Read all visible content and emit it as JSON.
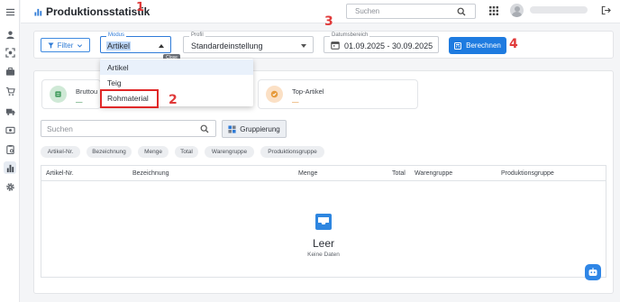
{
  "header": {
    "title": "Produktionsstatistik",
    "annotation_1": "1",
    "search_placeholder": "Suchen"
  },
  "sidebar": {
    "icons": [
      "menu-icon",
      "user-icon",
      "scan-icon",
      "briefcase-icon",
      "cart-icon",
      "truck-icon",
      "cash-icon",
      "clipboard-icon",
      "chart-icon",
      "gear-icon"
    ],
    "active": "chart-icon"
  },
  "filterbar": {
    "filter_label": "Filter",
    "modus": {
      "label": "Modus",
      "value": "Artikel"
    },
    "profil": {
      "label": "Profil",
      "value": "Standardeinstellung"
    },
    "datum": {
      "label": "Datumsbereich",
      "value": "01.09.2025 - 30.09.2025"
    },
    "annotation_3": "3",
    "berechnen_label": "Berechnen",
    "annotation_4": "4"
  },
  "dropdown": {
    "options": [
      "Artikel",
      "Teig",
      "Rohmaterial"
    ],
    "selected": "Artikel",
    "close_tooltip": "Close",
    "annotation_2": "2"
  },
  "stats": [
    {
      "label": "Bruttou",
      "value": "—",
      "color": "#2f8a4a"
    },
    {
      "label": "Top-Artikel",
      "value": "—",
      "color": "#e08a2a"
    }
  ],
  "toolbar": {
    "search_placeholder": "Suchen",
    "grouping_label": "Gruppierung"
  },
  "chips": [
    "Artikel-Nr.",
    "Bezeichnung",
    "Menge",
    "Total",
    "Warengruppe",
    "Produktionsgruppe"
  ],
  "table": {
    "columns": [
      "Artikel-Nr.",
      "Bezeichnung",
      "Menge",
      "Total",
      "Warengruppe",
      "Produktionsgruppe"
    ],
    "empty_title": "Leer",
    "empty_subtitle": "Keine Daten"
  },
  "colors": {
    "accent": "#1e7be0",
    "annotation": "#e03a3a"
  }
}
